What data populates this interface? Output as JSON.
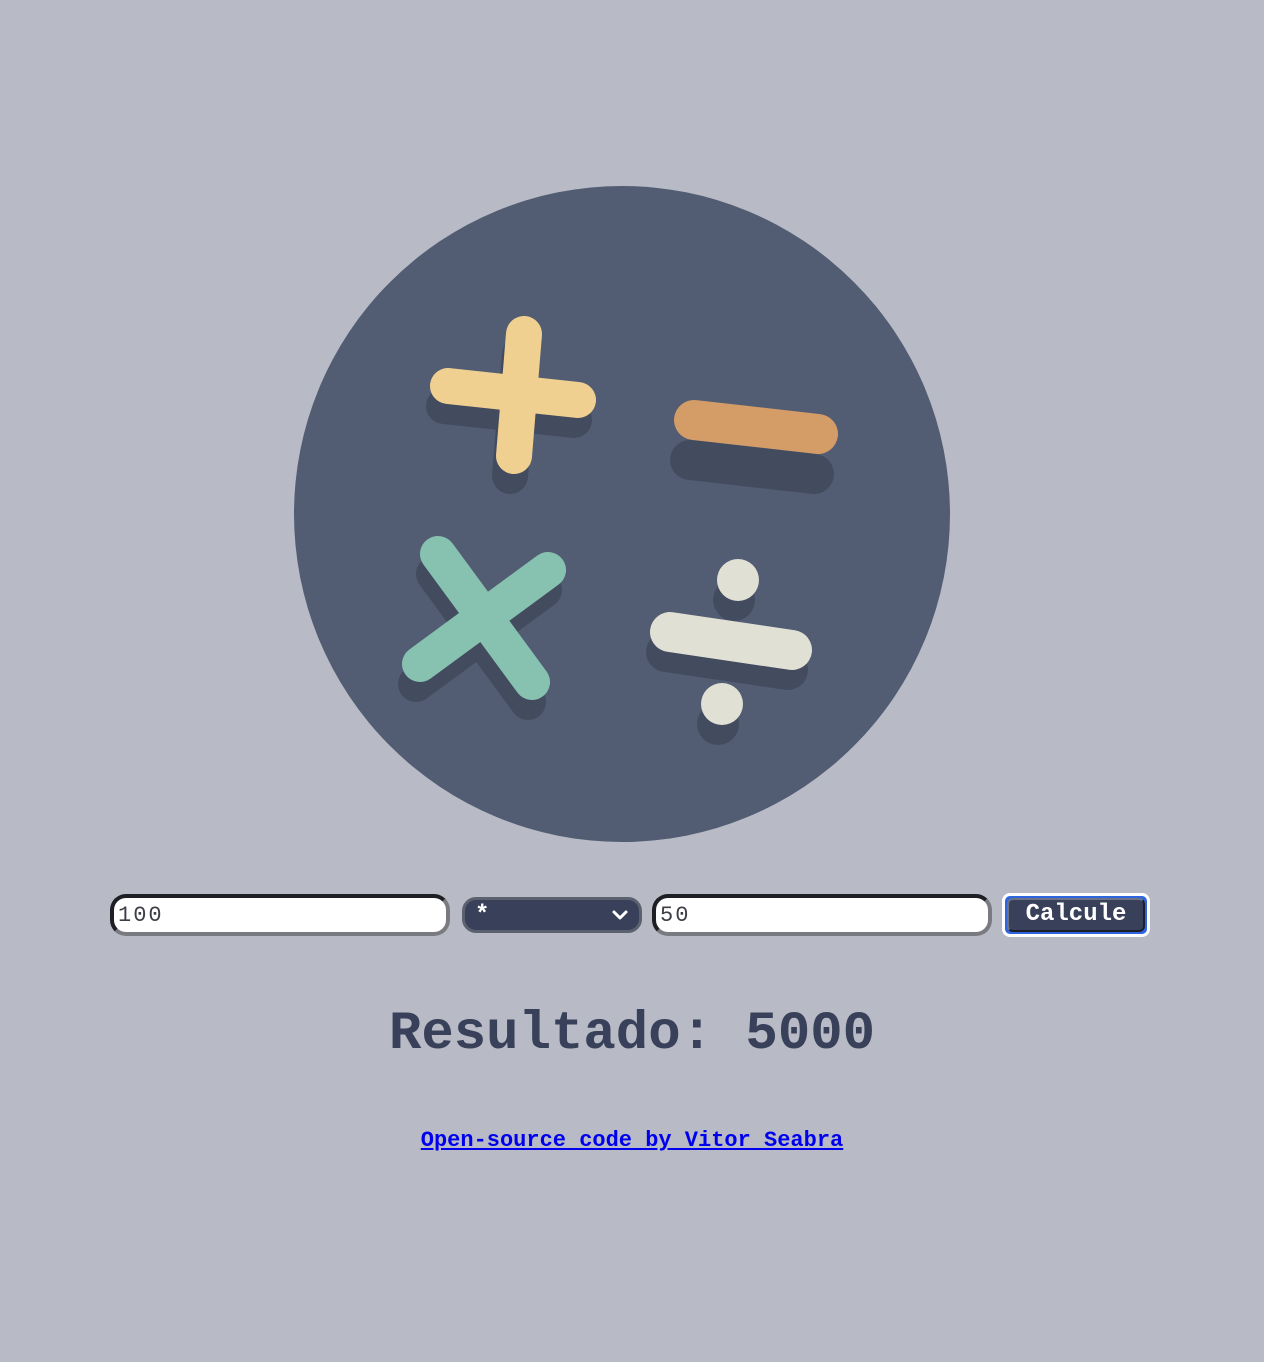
{
  "logo": {
    "icon": "math-operators-icon",
    "colors": {
      "circle": "#525c72",
      "plus": "#f0d091",
      "minus": "#d49c66",
      "times": "#87c2b1",
      "divide": "#e0e0d4",
      "shadow": "#434b5f"
    }
  },
  "form": {
    "first_number": "100",
    "operator": "*",
    "second_number": "50",
    "calculate_label": "Calcule"
  },
  "result": {
    "label": "Resultado:",
    "value": "5000"
  },
  "footer": {
    "link_text": "Open-source code by Vitor Seabra"
  },
  "colors": {
    "background": "#b8bbc5",
    "accent": "#384159",
    "link": "#0000ee"
  }
}
